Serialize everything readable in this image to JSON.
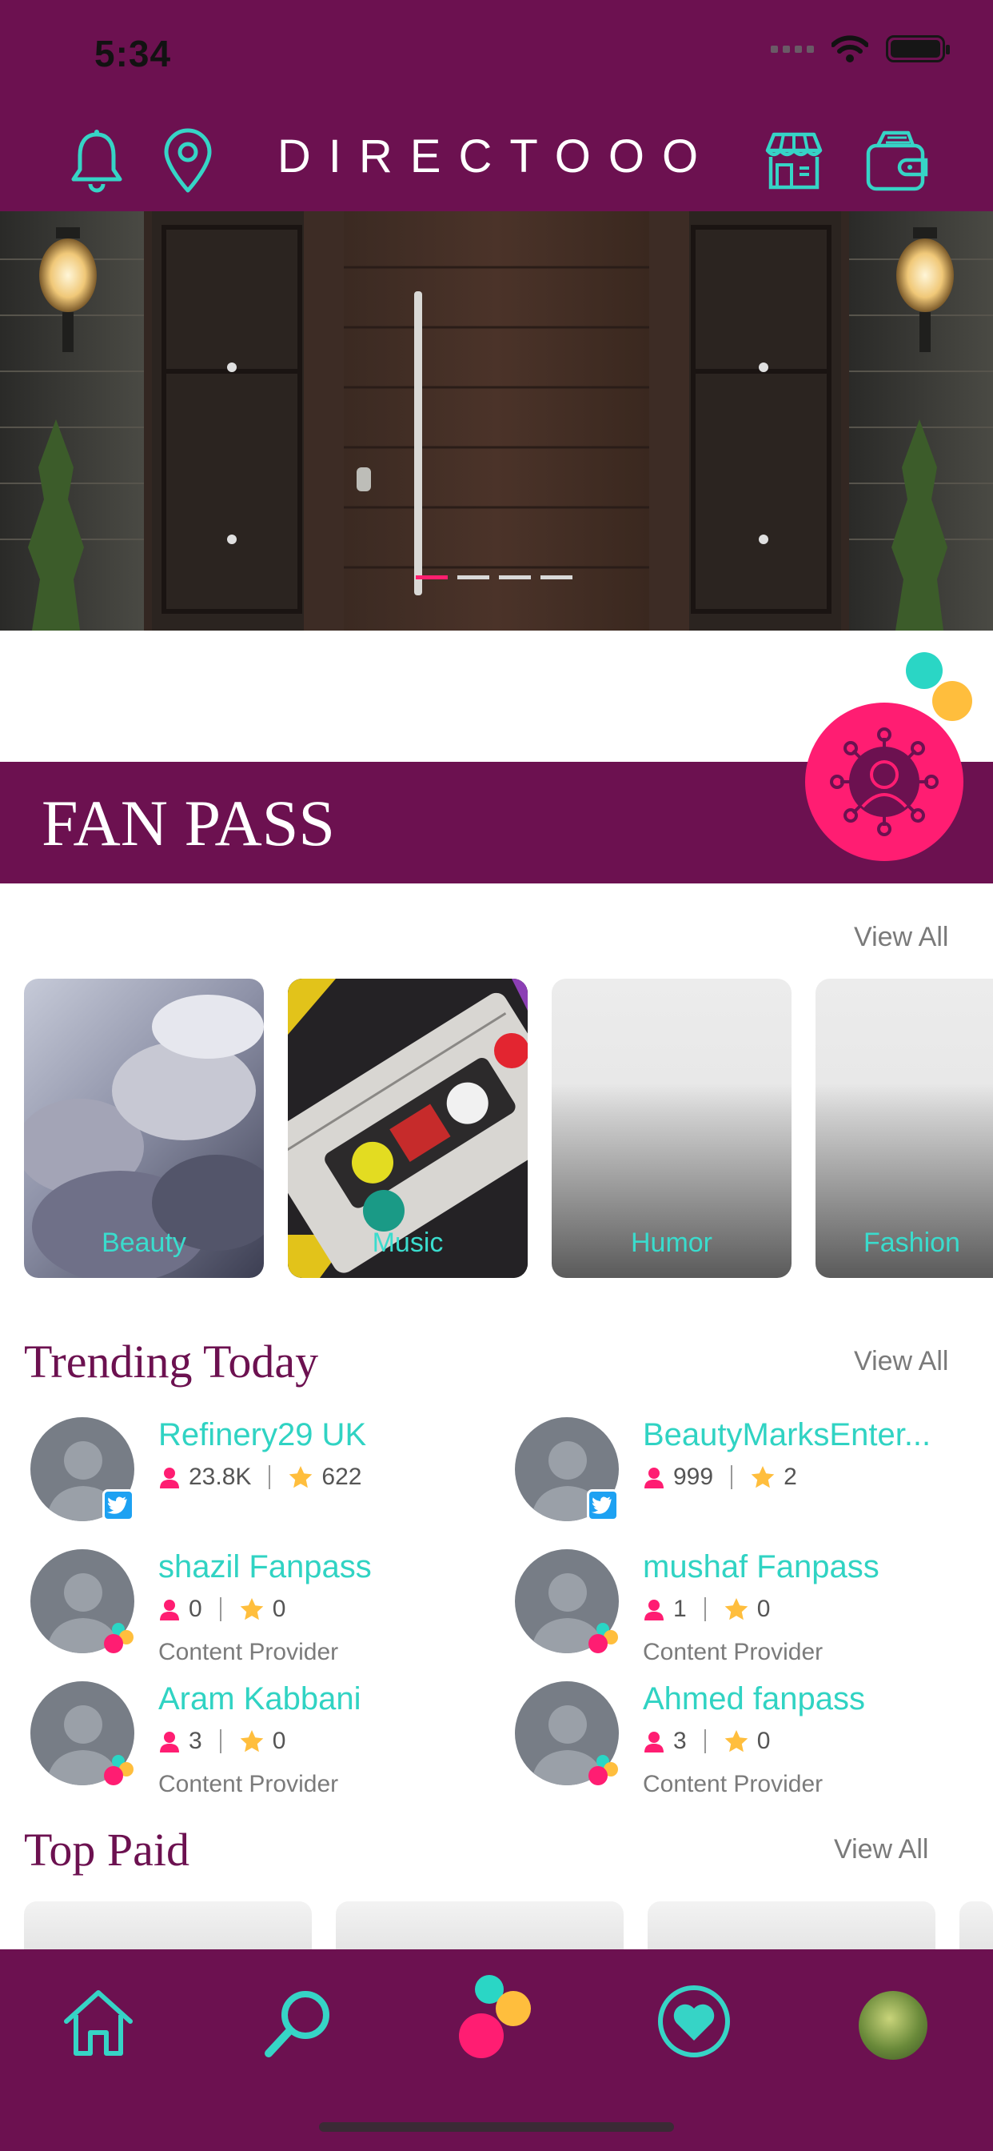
{
  "status_bar": {
    "time": "5:34"
  },
  "header": {
    "brand": "DIRECTOOO",
    "icons": [
      "bell-icon",
      "location-pin-icon",
      "store-icon",
      "wallet-icon"
    ]
  },
  "carousel": {
    "page_count": 4,
    "active_index": 0
  },
  "fan_pass": {
    "title": "FAN PASS"
  },
  "categories": {
    "view_all": "View All",
    "items": [
      {
        "label": "Beauty"
      },
      {
        "label": "Music"
      },
      {
        "label": "Humor"
      },
      {
        "label": "Fashion"
      }
    ]
  },
  "trending": {
    "title": "Trending Today",
    "view_all": "View All",
    "items": [
      {
        "name": "Refinery29 UK",
        "followers": "23.8K",
        "stars": "622",
        "role": "",
        "badge": "twitter"
      },
      {
        "name": "BeautyMarksEnter...",
        "followers": "999",
        "stars": "2",
        "role": "",
        "badge": "twitter"
      },
      {
        "name": "shazil Fanpass",
        "followers": "0",
        "stars": "0",
        "role": "Content Provider",
        "badge": "fanpass"
      },
      {
        "name": "mushaf Fanpass",
        "followers": "1",
        "stars": "0",
        "role": "Content Provider",
        "badge": "fanpass"
      },
      {
        "name": "Aram Kabbani",
        "followers": "3",
        "stars": "0",
        "role": "Content Provider",
        "badge": "fanpass"
      },
      {
        "name": "Ahmed fanpass",
        "followers": "3",
        "stars": "0",
        "role": "Content Provider",
        "badge": "fanpass"
      }
    ]
  },
  "top_paid": {
    "title": "Top Paid",
    "view_all": "View All"
  },
  "colors": {
    "brand_purple": "#6c1150",
    "accent_teal": "#30d3c3",
    "accent_pink": "#ff1d72",
    "accent_yellow": "#ffbe3d"
  },
  "bottom_nav": {
    "items": [
      "home-icon",
      "search-icon",
      "fanpass-logo-icon",
      "heart-icon",
      "profile-avatar"
    ]
  }
}
